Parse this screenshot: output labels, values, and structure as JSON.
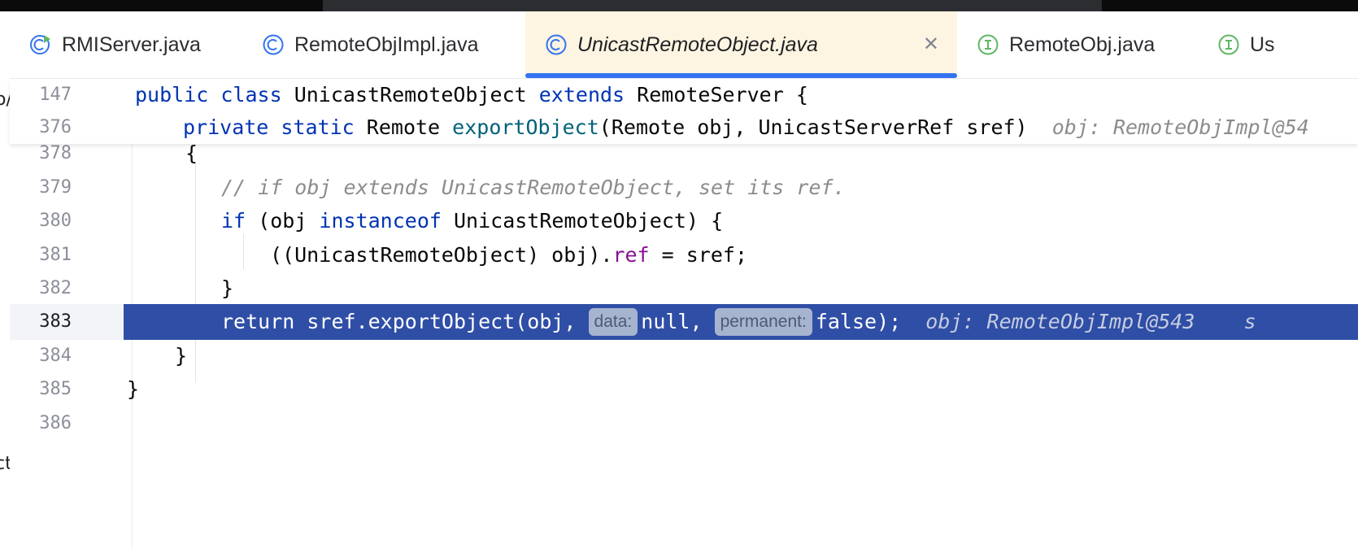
{
  "tabs": [
    {
      "label": "RMIServer.java",
      "icon": "run-class-icon",
      "active": false
    },
    {
      "label": "RemoteObjImpl.java",
      "icon": "class-icon",
      "active": false
    },
    {
      "label": "UnicastRemoteObject.java",
      "icon": "class-icon",
      "active": true
    },
    {
      "label": "RemoteObj.java",
      "icon": "interface-icon",
      "active": false
    },
    {
      "label": "Us",
      "icon": "interface-icon",
      "active": false
    }
  ],
  "left_sliver": {
    "top_char": "o/",
    "bottom_char": "ct"
  },
  "sticky": {
    "line_147": {
      "num": "147",
      "kw1": "public",
      "kw2": "class",
      "name": "UnicastRemoteObject",
      "kw3": "extends",
      "parent": "RemoteServer",
      "brace": "{"
    },
    "line_376": {
      "num": "376",
      "kw1": "private",
      "kw2": "static",
      "ret": "Remote",
      "method": "exportObject",
      "params": "(Remote obj, UnicastServerRef sref)",
      "hint": "obj: RemoteObjImpl@54"
    }
  },
  "lines": {
    "l378": {
      "num": "378",
      "text": "{"
    },
    "l379": {
      "num": "379",
      "comment": "// if obj extends UnicastRemoteObject, set its ref."
    },
    "l380": {
      "num": "380",
      "kw_if": "if",
      "p1": " (obj ",
      "kw_inst": "instanceof",
      "p2": " UnicastRemoteObject) {"
    },
    "l381": {
      "num": "381",
      "p1": "((UnicastRemoteObject) obj).",
      "field": "ref",
      "p2": " = sref;"
    },
    "l382": {
      "num": "382",
      "text": "}"
    },
    "l383": {
      "num": "383",
      "p1": "return sref.exportObject(obj, ",
      "hint1": "data:",
      "p2": "null, ",
      "hint2": "permanent:",
      "p3": "false);",
      "inline_hint": "obj: RemoteObjImpl@543",
      "tail": "s"
    },
    "l384": {
      "num": "384",
      "text": "}"
    },
    "l385": {
      "num": "385",
      "text": "}"
    },
    "l386": {
      "num": "386"
    }
  },
  "colors": {
    "keyword": "#0033b3",
    "method": "#00627a",
    "field": "#871094",
    "comment": "#8c8c8c",
    "exec_line": "#2f4ea6",
    "active_tab_bg": "#fdf5e1",
    "tab_underline": "#3574f0"
  }
}
